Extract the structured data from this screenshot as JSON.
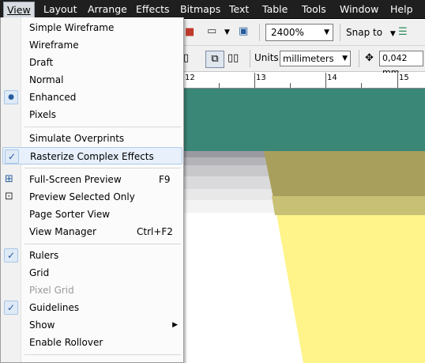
{
  "menubar": {
    "items": [
      "View",
      "Layout",
      "Arrange",
      "Effects",
      "Bitmaps",
      "Text",
      "Table",
      "Tools",
      "Window",
      "Help"
    ]
  },
  "toolbar": {
    "zoom_value": "2400%",
    "snap_to_label": "Snap to",
    "units_label": "Units:",
    "units_value": "millimeters",
    "nudge_value": "0,042 mm"
  },
  "ruler": {
    "labels": [
      "12",
      "13",
      "14",
      "15"
    ]
  },
  "view_menu": {
    "items": [
      {
        "label": "Simple Wireframe",
        "u": "S",
        "state": "none"
      },
      {
        "label": "Wireframe",
        "u": "W",
        "state": "none"
      },
      {
        "label": "Draft",
        "u": "D",
        "state": "none"
      },
      {
        "label": "Normal",
        "u": "N",
        "state": "none"
      },
      {
        "label": "Enhanced",
        "u": "E",
        "state": "radio"
      },
      {
        "label": "Pixels",
        "u": "x",
        "state": "none"
      },
      {
        "label": "Simulate Overprints",
        "u": "O",
        "state": "none"
      },
      {
        "label": "Rasterize Complex Effects",
        "u": "z",
        "state": "checked"
      },
      {
        "label": "Full-Screen Preview",
        "u": "F",
        "shortcut": "F9",
        "icon": "full-screen-preview-icon"
      },
      {
        "label": "Preview Selected Only",
        "u": "O",
        "icon": "preview-selected-icon"
      },
      {
        "label": "Page Sorter View",
        "u": "a"
      },
      {
        "label": "View Manager",
        "u": "w",
        "shortcut": "Ctrl+F2"
      },
      {
        "label": "Rulers",
        "u": "R",
        "state": "checked"
      },
      {
        "label": "Grid",
        "u": "G"
      },
      {
        "label": "Pixel Grid",
        "u": "l",
        "disabled": true
      },
      {
        "label": "Guidelines",
        "u": "i",
        "state": "checked"
      },
      {
        "label": "Show",
        "u": "h",
        "submenu": true
      },
      {
        "label": "Enable Rollover",
        "u": "v"
      }
    ]
  },
  "colors": {
    "menubar_bg": "#1f1f1f",
    "teal": "#3a8677",
    "yellow": "#fef48a",
    "olive": "#a99f5c",
    "highlight": "#e7f0fb"
  }
}
